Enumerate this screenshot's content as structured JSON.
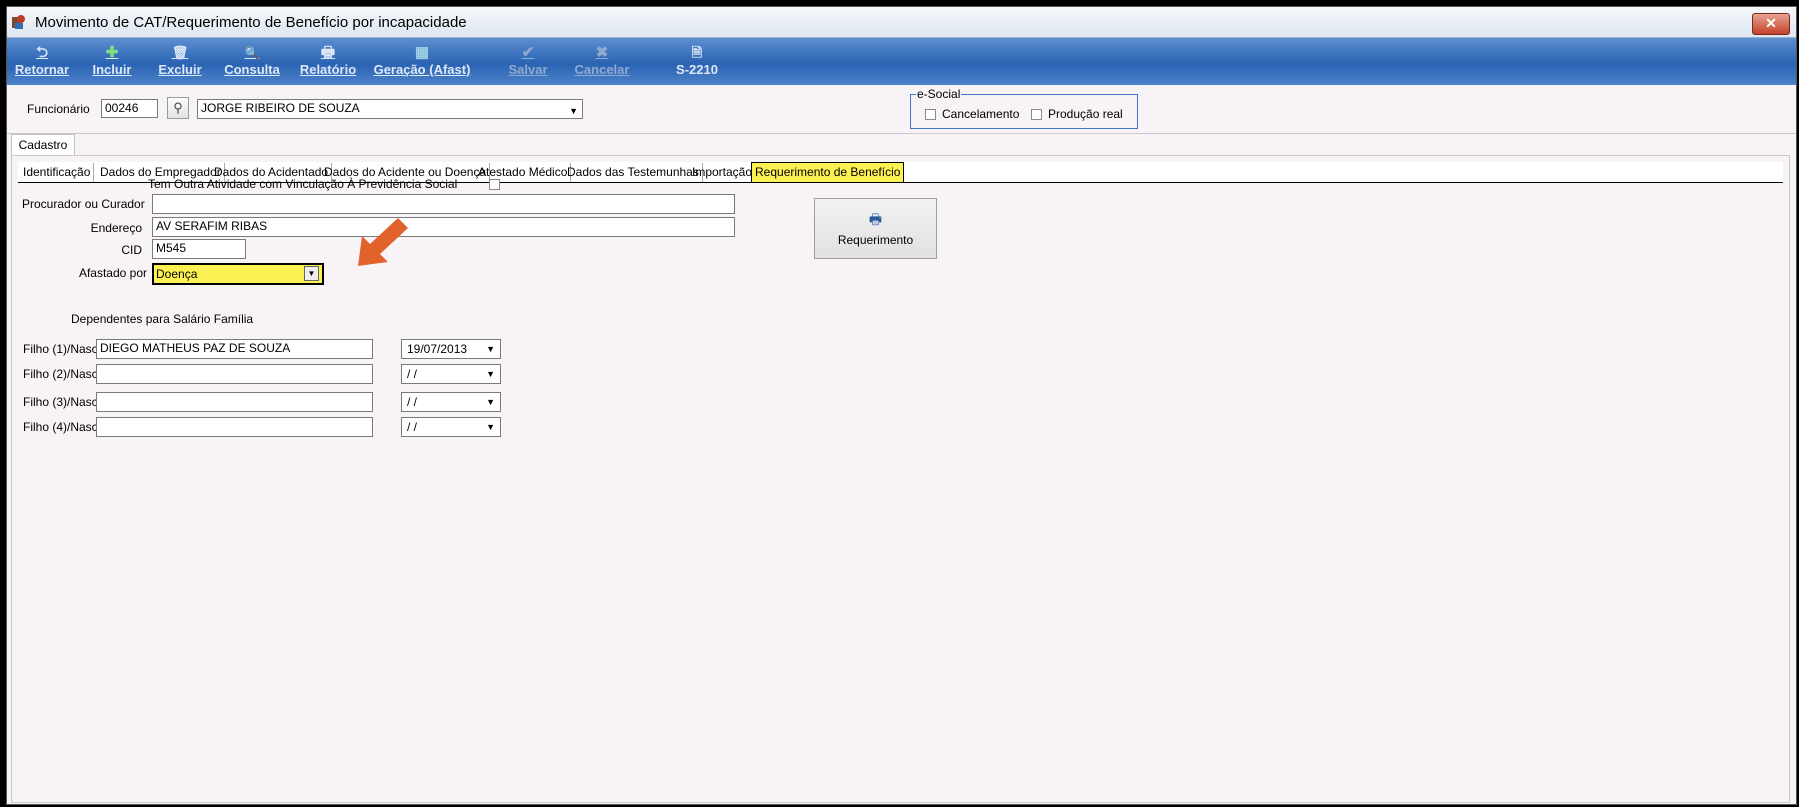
{
  "window": {
    "title": "Movimento de CAT/Requerimento de Benefício por incapacidade",
    "close_label": "✕"
  },
  "toolbar": {
    "buttons": [
      {
        "label": "Retornar",
        "icon": "undo-icon",
        "glyph": "⮌"
      },
      {
        "label": "Incluir",
        "icon": "add-icon",
        "glyph": "✚"
      },
      {
        "label": "Excluir",
        "icon": "delete-icon",
        "glyph": "🗑"
      },
      {
        "label": "Consulta",
        "icon": "search-icon",
        "glyph": "🔍"
      },
      {
        "label": "Relatório",
        "icon": "print-icon",
        "glyph": "🖶"
      },
      {
        "label": "Geração (Afast)",
        "icon": "grid-icon",
        "glyph": "▦"
      },
      {
        "label": "Salvar",
        "icon": "check-icon",
        "glyph": "✔"
      },
      {
        "label": "Cancelar",
        "icon": "cancel-icon",
        "glyph": "✖"
      },
      {
        "label": "S-2210",
        "icon": "document-icon",
        "glyph": "🗎"
      }
    ]
  },
  "funcionario": {
    "label": "Funcionário",
    "code": "00246",
    "name": "JORGE RIBEIRO DE SOUZA"
  },
  "esocial": {
    "legend": "e-Social",
    "cancelamento_label": "Cancelamento",
    "producao_label": "Produção real"
  },
  "tabs": {
    "main": "Cadastro",
    "sub": [
      "Identificação",
      "Dados do Empregador",
      "Dados do Acidentado",
      "Dados do Acidente ou Doença",
      "Atestado Médico",
      "Dados das Testemunhas",
      "Importação",
      "Requerimento de Benefício"
    ],
    "active_sub": "Requerimento de Benefício"
  },
  "form": {
    "outra_atividade_label": "Tem Outra Atividade com Vinculação À Previdência Social",
    "procurador_label": "Procurador ou Curador",
    "procurador_value": "",
    "endereco_label": "Endereço",
    "endereco_value": "AV SERAFIM RIBAS",
    "cid_label": "CID",
    "cid_value": "M545",
    "afastado_label": "Afastado por",
    "afastado_value": "Doença",
    "requerimento_button": "Requerimento"
  },
  "dependentes": {
    "heading": "Dependentes para Salário Família",
    "rows": [
      {
        "label": "Filho (1)/Nasc",
        "name": "DIEGO MATHEUS PAZ DE SOUZA",
        "date": "19/07/2013"
      },
      {
        "label": "Filho (2)/Nasc",
        "name": "",
        "date": " / /"
      },
      {
        "label": "Filho (3)/Nasc",
        "name": "",
        "date": " / /"
      },
      {
        "label": "Filho (4)/Nasc",
        "name": "",
        "date": " / /"
      }
    ]
  },
  "colors": {
    "highlight": "#fcf152",
    "toolbar": "#2a63b3",
    "arrow": "#e2622c"
  }
}
